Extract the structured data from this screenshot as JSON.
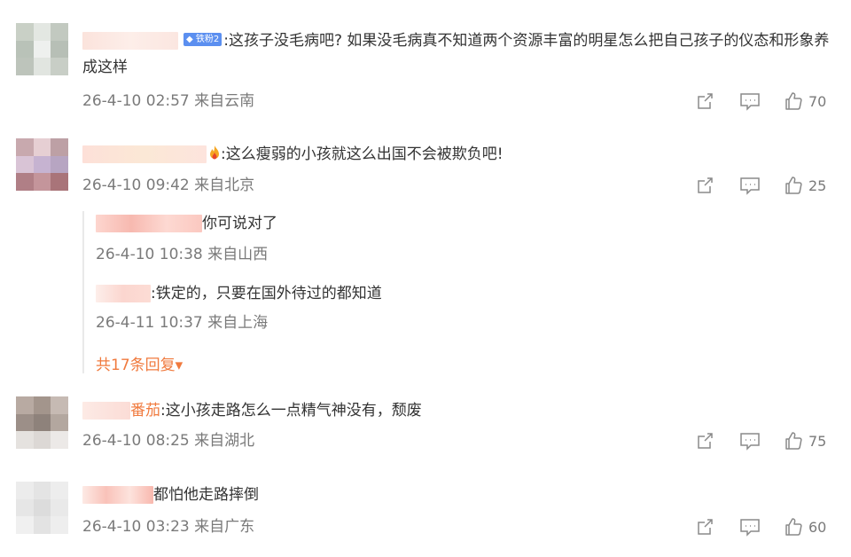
{
  "comments": [
    {
      "badge": "铁粉2",
      "text": ":这孩子没毛病吧? 如果没毛病真不知道两个资源丰富的明星怎么把自己孩子的仪态和形象养成这样",
      "time": "26-4-10 02:57",
      "location": "来自云南",
      "likes": "70"
    },
    {
      "text": ":这么瘦弱的小孩就这么出国不会被欺负吧!",
      "time": "26-4-10 09:42",
      "location": "来自北京",
      "likes": "25",
      "replies": [
        {
          "text": "你可说对了",
          "time": "26-4-10 10:38",
          "location": "来自山西"
        },
        {
          "text": ":铁定的，只要在国外待过的都知道",
          "time": "26-4-11 10:37",
          "location": "来自上海"
        }
      ],
      "more_replies": "共17条回复▾"
    },
    {
      "name_visible": "番茄",
      "text": ":这小孩走路怎么一点精气神没有，颓废",
      "time": "26-4-10 08:25",
      "location": "来自湖北",
      "likes": "75"
    },
    {
      "text": "都怕他走路摔倒",
      "time": "26-4-10 03:23",
      "location": "来自广东",
      "likes": "60"
    }
  ],
  "icons": {
    "share": "share-icon",
    "comment": "comment-icon",
    "like": "thumbs-up-icon"
  },
  "colors": {
    "text": "#333333",
    "meta": "#7a7a7a",
    "accent": "#f07a3e",
    "badge": "#5b8ff0"
  }
}
